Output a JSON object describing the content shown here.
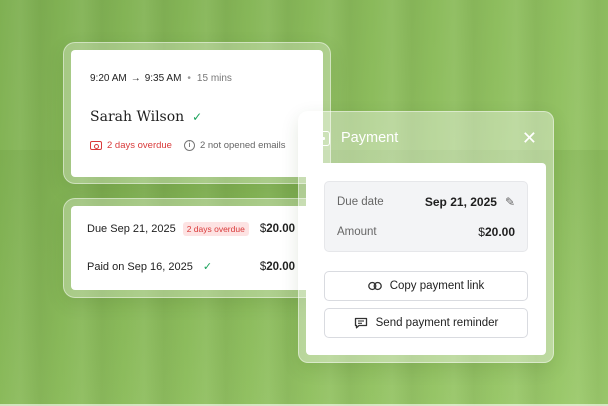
{
  "appointment": {
    "start_time": "9:20 AM",
    "arrow": "→",
    "end_time": "9:35 AM",
    "separator": "•",
    "duration": "15 mins",
    "client_name": "Sarah Wilson",
    "check_glyph": "✓",
    "overdue_text": "2 days overdue",
    "info_glyph": "i",
    "emails_text": "2 not opened emails"
  },
  "payments_list": [
    {
      "label": "Due Sep 21, 2025",
      "badge": "2 days overdue",
      "currency": "$",
      "amount": "20.00"
    },
    {
      "label": "Paid on Sep 16, 2025",
      "check": "✓",
      "currency": "$",
      "amount": "20.00"
    }
  ],
  "payment_panel": {
    "title": "Payment",
    "close_glyph": "✕",
    "due_date_label": "Due date",
    "due_date_value": "Sep 21, 2025",
    "edit_glyph": "✎",
    "amount_label": "Amount",
    "amount_currency": "$",
    "amount_value": "20.00",
    "copy_link_label": "Copy payment link",
    "copy_icon": "link-icon",
    "reminder_label": "Send payment reminder",
    "reminder_icon": "message-icon"
  },
  "colors": {
    "background": "#8cbc5c",
    "overdue_red": "#d93a3a",
    "success_green": "#1aa35b"
  }
}
